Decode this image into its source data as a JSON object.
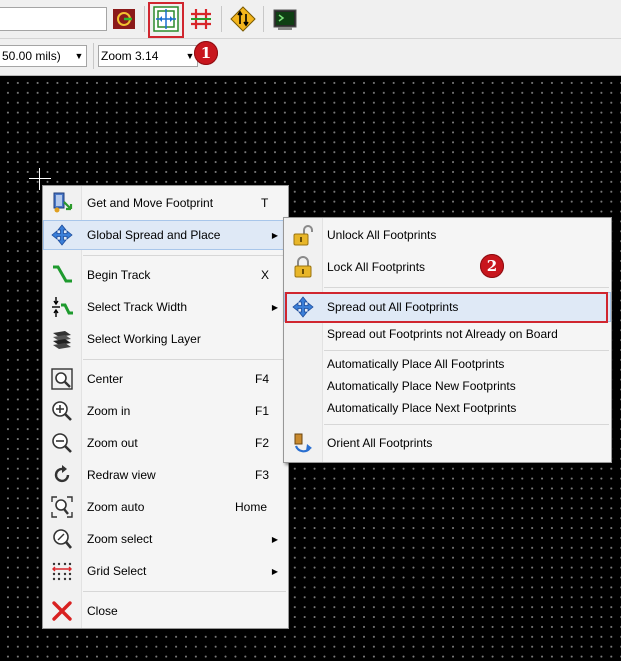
{
  "toolbar": {
    "icons": [
      "zone-fill-icon",
      "footprint-mode-icon",
      "track-mode-icon",
      "autorouter-icon",
      "scripting-console-icon"
    ]
  },
  "selectors": {
    "grid_value": "50.00 mils)",
    "zoom_value": "Zoom 3.14"
  },
  "callouts": {
    "one": "1",
    "two": "2"
  },
  "context_menu": {
    "items": [
      {
        "label": "Get and Move Footprint",
        "shortcut": "T",
        "icon": "get-move-footprint-icon"
      },
      {
        "label": "Global Spread and Place",
        "shortcut": "",
        "icon": "move-arrows-icon",
        "submenu": true
      },
      {
        "label": "Begin Track",
        "shortcut": "X",
        "icon": "track-icon"
      },
      {
        "label": "Select Track Width",
        "shortcut": "",
        "icon": "track-width-icon",
        "submenu": true
      },
      {
        "label": "Select Working Layer",
        "shortcut": "",
        "icon": "layers-icon"
      },
      {
        "label": "Center",
        "shortcut": "F4",
        "icon": "zoom-center-icon"
      },
      {
        "label": "Zoom in",
        "shortcut": "F1",
        "icon": "zoom-in-icon"
      },
      {
        "label": "Zoom out",
        "shortcut": "F2",
        "icon": "zoom-out-icon"
      },
      {
        "label": "Redraw view",
        "shortcut": "F3",
        "icon": "redraw-icon"
      },
      {
        "label": "Zoom auto",
        "shortcut": "Home",
        "icon": "zoom-auto-icon"
      },
      {
        "label": "Zoom select",
        "shortcut": "",
        "icon": "zoom-select-icon",
        "submenu": true
      },
      {
        "label": "Grid Select",
        "shortcut": "",
        "icon": "grid-icon",
        "submenu": true
      },
      {
        "label": "Close",
        "shortcut": "",
        "icon": "close-icon"
      }
    ],
    "submenu_arrow": "▶"
  },
  "submenu": {
    "items": [
      {
        "label": "Unlock All Footprints",
        "icon": "unlock-icon"
      },
      {
        "label": "Lock All Footprints",
        "icon": "lock-icon"
      },
      {
        "label": "Spread out All Footprints",
        "icon": "move-arrows-icon"
      },
      {
        "label": "Spread out Footprints not Already on Board",
        "icon": ""
      },
      {
        "label": "Automatically Place All Footprints",
        "icon": ""
      },
      {
        "label": "Automatically Place New Footprints",
        "icon": ""
      },
      {
        "label": "Automatically Place Next Footprints",
        "icon": ""
      },
      {
        "label": "Orient All Footprints",
        "icon": "orient-icon"
      }
    ]
  },
  "colors": {
    "callout_red": "#d0262f",
    "highlight": "#dfe9f6",
    "canvas": "#000000"
  }
}
